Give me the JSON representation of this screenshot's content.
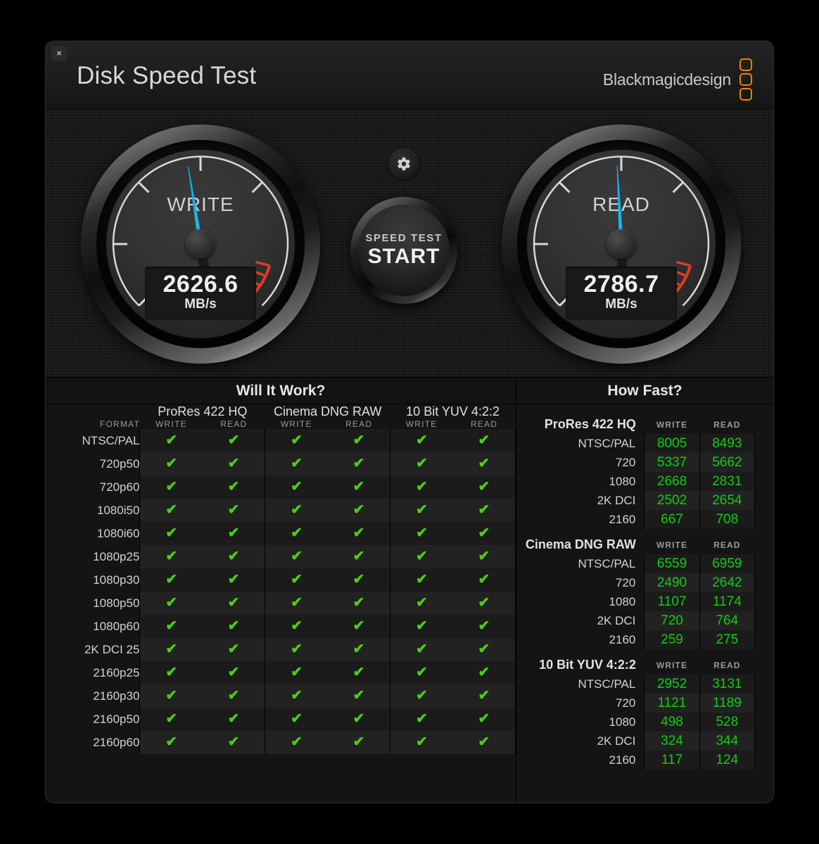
{
  "window": {
    "close_label": "×",
    "title": "Disk Speed Test",
    "brand_text": "Blackmagicdesign"
  },
  "gauges": {
    "write": {
      "label": "WRITE",
      "value": "2626.6",
      "unit": "MB/s",
      "needle_angle_deg": -9
    },
    "read": {
      "label": "READ",
      "value": "2786.7",
      "unit": "MB/s",
      "needle_angle_deg": -3
    },
    "needle_color": "#00b3ef",
    "redzone_color": "#e03b26",
    "arc_color": "#d8d8d8"
  },
  "controls": {
    "gear_icon": "gear-icon",
    "start_top": "SPEED TEST",
    "start_main": "START"
  },
  "will_it_work": {
    "panel_title": "Will It Work?",
    "format_header": "FORMAT",
    "groups": [
      {
        "name": "ProRes 422 HQ",
        "write": "WRITE",
        "read": "READ"
      },
      {
        "name": "Cinema DNG RAW",
        "write": "WRITE",
        "read": "READ"
      },
      {
        "name": "10 Bit YUV 4:2:2",
        "write": "WRITE",
        "read": "READ"
      }
    ],
    "check_glyph": "✔",
    "rows": [
      {
        "format": "NTSC/PAL",
        "cells": [
          true,
          true,
          true,
          true,
          true,
          true
        ]
      },
      {
        "format": "720p50",
        "cells": [
          true,
          true,
          true,
          true,
          true,
          true
        ]
      },
      {
        "format": "720p60",
        "cells": [
          true,
          true,
          true,
          true,
          true,
          true
        ]
      },
      {
        "format": "1080i50",
        "cells": [
          true,
          true,
          true,
          true,
          true,
          true
        ]
      },
      {
        "format": "1080i60",
        "cells": [
          true,
          true,
          true,
          true,
          true,
          true
        ]
      },
      {
        "format": "1080p25",
        "cells": [
          true,
          true,
          true,
          true,
          true,
          true
        ]
      },
      {
        "format": "1080p30",
        "cells": [
          true,
          true,
          true,
          true,
          true,
          true
        ]
      },
      {
        "format": "1080p50",
        "cells": [
          true,
          true,
          true,
          true,
          true,
          true
        ]
      },
      {
        "format": "1080p60",
        "cells": [
          true,
          true,
          true,
          true,
          true,
          true
        ]
      },
      {
        "format": "2K DCI 25",
        "cells": [
          true,
          true,
          true,
          true,
          true,
          true
        ]
      },
      {
        "format": "2160p25",
        "cells": [
          true,
          true,
          true,
          true,
          true,
          true
        ]
      },
      {
        "format": "2160p30",
        "cells": [
          true,
          true,
          true,
          true,
          true,
          true
        ]
      },
      {
        "format": "2160p50",
        "cells": [
          true,
          true,
          true,
          true,
          true,
          true
        ]
      },
      {
        "format": "2160p60",
        "cells": [
          true,
          true,
          true,
          true,
          true,
          true
        ]
      }
    ]
  },
  "how_fast": {
    "panel_title": "How Fast?",
    "write_header": "WRITE",
    "read_header": "READ",
    "sections": [
      {
        "name": "ProRes 422 HQ",
        "rows": [
          {
            "format": "NTSC/PAL",
            "write": "8005",
            "read": "8493"
          },
          {
            "format": "720",
            "write": "5337",
            "read": "5662"
          },
          {
            "format": "1080",
            "write": "2668",
            "read": "2831"
          },
          {
            "format": "2K DCI",
            "write": "2502",
            "read": "2654"
          },
          {
            "format": "2160",
            "write": "667",
            "read": "708"
          }
        ]
      },
      {
        "name": "Cinema DNG RAW",
        "rows": [
          {
            "format": "NTSC/PAL",
            "write": "6559",
            "read": "6959"
          },
          {
            "format": "720",
            "write": "2490",
            "read": "2642"
          },
          {
            "format": "1080",
            "write": "1107",
            "read": "1174"
          },
          {
            "format": "2K DCI",
            "write": "720",
            "read": "764"
          },
          {
            "format": "2160",
            "write": "259",
            "read": "275"
          }
        ]
      },
      {
        "name": "10 Bit YUV 4:2:2",
        "rows": [
          {
            "format": "NTSC/PAL",
            "write": "2952",
            "read": "3131"
          },
          {
            "format": "720",
            "write": "1121",
            "read": "1189"
          },
          {
            "format": "1080",
            "write": "498",
            "read": "528"
          },
          {
            "format": "2K DCI",
            "write": "324",
            "read": "344"
          },
          {
            "format": "2160",
            "write": "117",
            "read": "124"
          }
        ]
      }
    ]
  }
}
